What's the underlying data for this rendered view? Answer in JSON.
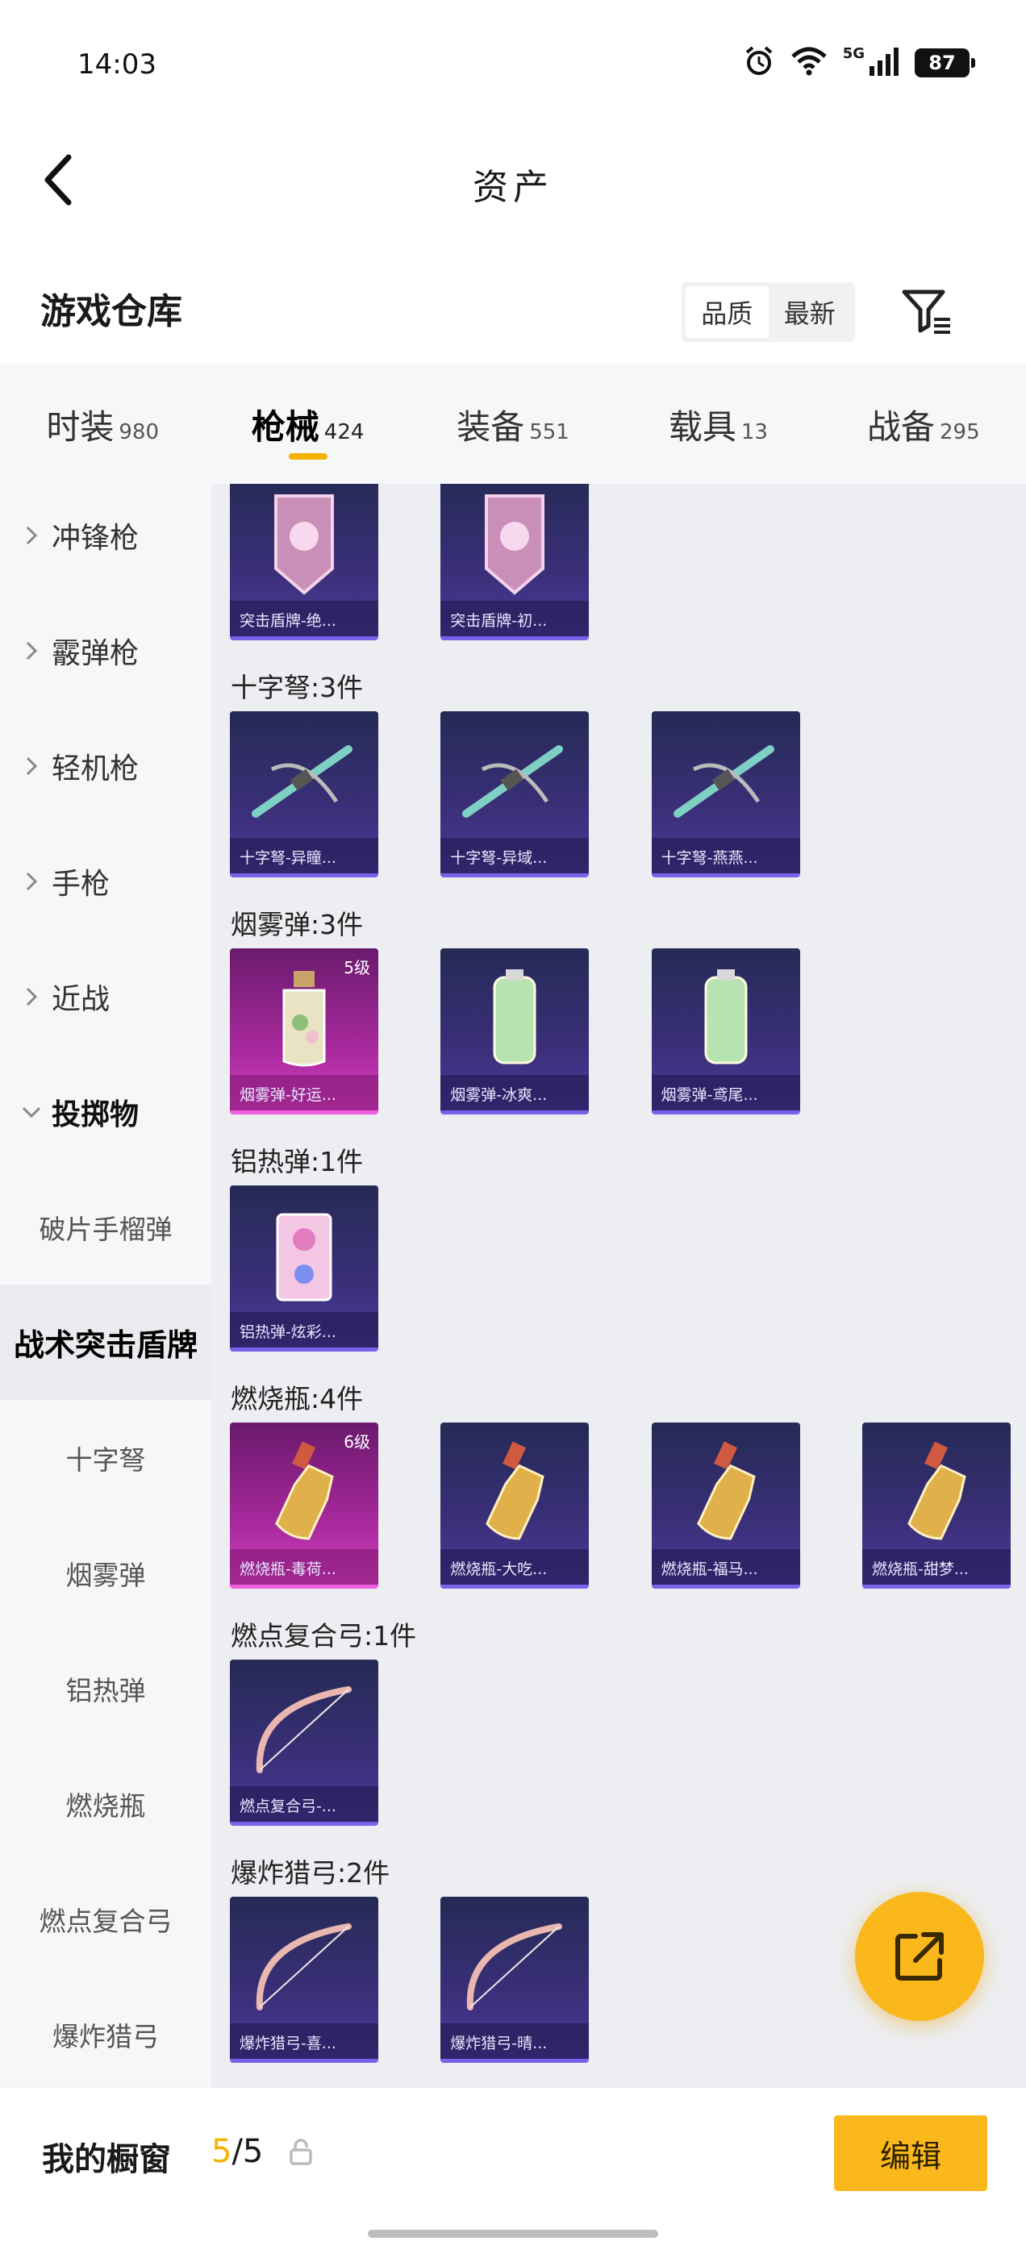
{
  "status_bar": {
    "time": "14:03",
    "network": "5G",
    "battery": "87"
  },
  "nav": {
    "title": "资产"
  },
  "section": {
    "title": "游戏仓库",
    "sort_options": [
      "品质",
      "最新"
    ],
    "active_sort": 0
  },
  "tabs": [
    {
      "label": "时装",
      "count": "980"
    },
    {
      "label": "枪械",
      "count": "424"
    },
    {
      "label": "装备",
      "count": "551"
    },
    {
      "label": "载具",
      "count": "13"
    },
    {
      "label": "战备",
      "count": "295"
    }
  ],
  "active_tab": 1,
  "sidebar": [
    {
      "label": "冲锋枪",
      "kind": "collapsed"
    },
    {
      "label": "霰弹枪",
      "kind": "collapsed"
    },
    {
      "label": "轻机枪",
      "kind": "collapsed"
    },
    {
      "label": "手枪",
      "kind": "collapsed"
    },
    {
      "label": "近战",
      "kind": "collapsed"
    },
    {
      "label": "投掷物",
      "kind": "expanded"
    },
    {
      "label": "破片手榴弹",
      "kind": "sub"
    },
    {
      "label": "战术突击盾牌",
      "kind": "selected"
    },
    {
      "label": "十字弩",
      "kind": "sub"
    },
    {
      "label": "烟雾弹",
      "kind": "sub"
    },
    {
      "label": "铝热弹",
      "kind": "sub"
    },
    {
      "label": "燃烧瓶",
      "kind": "sub"
    },
    {
      "label": "燃点复合弓",
      "kind": "sub"
    },
    {
      "label": "爆炸猎弓",
      "kind": "sub"
    }
  ],
  "groups": [
    {
      "label": "",
      "items": [
        {
          "caption": "突击盾牌-绝...",
          "style": "purple",
          "icon": "shield-icon"
        },
        {
          "caption": "突击盾牌-初...",
          "style": "purple",
          "icon": "shield-icon"
        }
      ]
    },
    {
      "label": "十字弩:3件",
      "items": [
        {
          "caption": "十字弩-异瞳...",
          "style": "purple",
          "icon": "crossbow-icon"
        },
        {
          "caption": "十字弩-异域...",
          "style": "purple",
          "icon": "crossbow-icon"
        },
        {
          "caption": "十字弩-燕燕...",
          "style": "purple",
          "icon": "crossbow-icon"
        }
      ]
    },
    {
      "label": "烟雾弹:3件",
      "items": [
        {
          "caption": "烟雾弹-好运...",
          "style": "pink",
          "level": "5级",
          "icon": "bottle-icon"
        },
        {
          "caption": "烟雾弹-冰爽...",
          "style": "purple",
          "icon": "canister-icon"
        },
        {
          "caption": "烟雾弹-鸢尾...",
          "style": "purple",
          "icon": "canister-icon"
        }
      ]
    },
    {
      "label": "铝热弹:1件",
      "items": [
        {
          "caption": "铝热弹-炫彩...",
          "style": "purple",
          "icon": "thermite-icon"
        }
      ]
    },
    {
      "label": "燃烧瓶:4件",
      "items": [
        {
          "caption": "燃烧瓶-毒荷...",
          "style": "pink",
          "level": "6级",
          "icon": "molotov-icon"
        },
        {
          "caption": "燃烧瓶-大吃...",
          "style": "purple",
          "icon": "molotov-icon"
        },
        {
          "caption": "燃烧瓶-福马...",
          "style": "purple",
          "icon": "molotov-icon"
        },
        {
          "caption": "燃烧瓶-甜梦...",
          "style": "purple",
          "icon": "molotov-icon"
        }
      ]
    },
    {
      "label": "燃点复合弓:1件",
      "items": [
        {
          "caption": "燃点复合弓-...",
          "style": "purple",
          "icon": "bow-icon"
        }
      ]
    },
    {
      "label": "爆炸猎弓:2件",
      "items": [
        {
          "caption": "爆炸猎弓-喜...",
          "style": "purple",
          "icon": "bow-icon"
        },
        {
          "caption": "爆炸猎弓-晴...",
          "style": "purple",
          "icon": "bow-icon"
        }
      ]
    }
  ],
  "bottom": {
    "label": "我的橱窗",
    "count_current": "5",
    "count_total": "/5",
    "edit_label": "编辑"
  },
  "colors": {
    "accent": "#fbb81c",
    "card_purple": "#3a2f78",
    "card_pink": "#a5289a"
  }
}
